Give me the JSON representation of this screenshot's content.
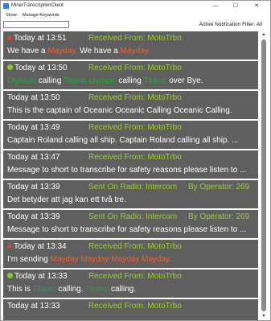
{
  "window": {
    "title": "MinerTranscriptionClient",
    "minimize": "—",
    "maximize": "☐",
    "close": "✕"
  },
  "menu": {
    "show": "Show",
    "manage_keywords": "Manage Keywords"
  },
  "toolbar": {
    "filter_value": "",
    "filter_label": "Active Notification Filter: All"
  },
  "items": [
    {
      "time": "Today at 13:51",
      "source": "Received From: MotoTrbo",
      "message": [
        [
          "We have a ",
          ""
        ],
        [
          "Mayday.",
          "red"
        ],
        [
          " We have a ",
          ""
        ],
        [
          "Mayday.",
          "red"
        ]
      ]
    },
    {
      "time": "Today at 13:50",
      "source": "Received From: MotoTrbo",
      "message": [
        [
          "Olympic",
          "grn"
        ],
        [
          " calling ",
          ""
        ],
        [
          "Titanic olympic",
          "grn"
        ],
        [
          " calling ",
          ""
        ],
        [
          "Titanic",
          "grn"
        ],
        [
          " over Bye.",
          ""
        ]
      ]
    },
    {
      "time": "Today at 13:50",
      "source": "Received From: MotoTrbo",
      "message": [
        [
          "This is the captain of Oceanic Oceanic Calling Oceanic Calling.",
          ""
        ]
      ]
    },
    {
      "time": "Today at 13:49",
      "source": "Received From: MotoTrbo",
      "message": [
        [
          "Captain Roland calling all ship. Captain Roland calling all ship. ...",
          ""
        ]
      ]
    },
    {
      "time": "Today at 13:47",
      "source": "Received From: MotoTrbo",
      "message": [
        [
          "Message to short to transcribe for safety reasons please listen to ...",
          ""
        ]
      ]
    },
    {
      "time": "Today at 13:39",
      "source": "Sent On Radio: Intercom",
      "operator": "By Operator: 269",
      "message": [
        [
          "Det betyder att jag kan ett två tre.",
          ""
        ]
      ]
    },
    {
      "time": "Today at 13:39",
      "source": "Sent On Radio: Intercom",
      "operator": "By Operator: 269",
      "message": [
        [
          "Message to short to transcribe for safety reasons please listen to ...",
          ""
        ]
      ]
    },
    {
      "time": "Today at 13:34",
      "source": "Received From: MotoTrbo",
      "message": [
        [
          "I'm sending ",
          ""
        ],
        [
          "Mayday Mayday Mayday Mayday.",
          "red"
        ]
      ]
    },
    {
      "time": "Today at 13:33",
      "source": "Received From: MotoTrbo",
      "message": [
        [
          "This is ",
          ""
        ],
        [
          "Titanic",
          "grn"
        ],
        [
          " calling. ",
          ""
        ],
        [
          "Titanic",
          "grn"
        ],
        [
          " calling.",
          ""
        ]
      ]
    },
    {
      "time": "Today at 13:33",
      "source": "Received From: MotoTrbo",
      "message": []
    }
  ],
  "colors": {
    "alert": "#ff5a2a",
    "keyword_ok": "#22a838",
    "source": "#9acd32",
    "row_bg": "#5f5f5f"
  },
  "icons": {
    "alert": "warning-triangle-icon",
    "ok": "green-dot-icon"
  }
}
